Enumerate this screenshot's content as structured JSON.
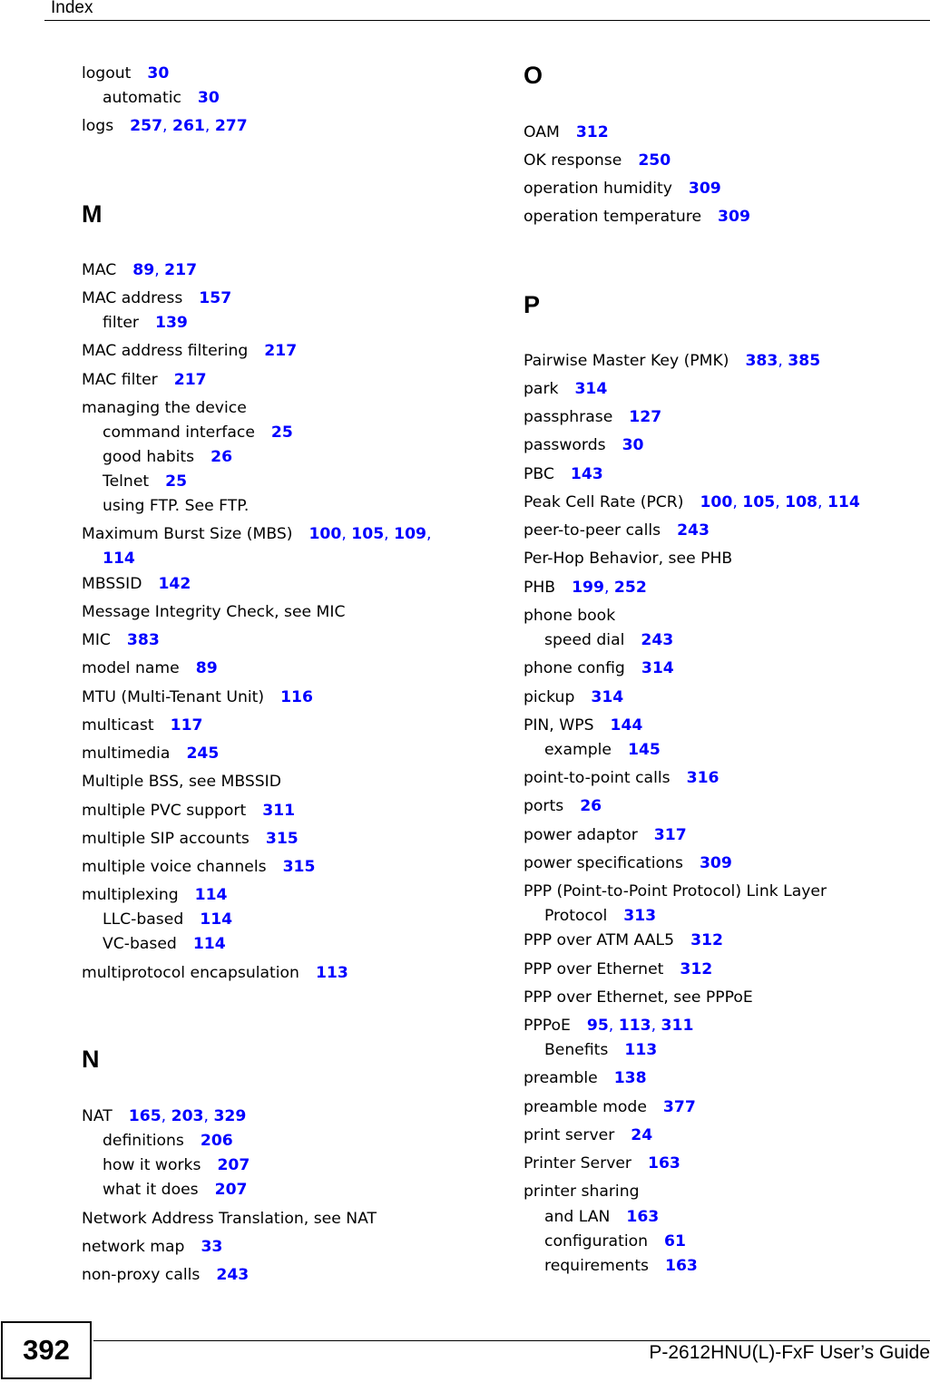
{
  "header": {
    "title": "Index"
  },
  "footer": {
    "page_number": "392",
    "guide_title": "P-2612HNU(L)-FxF User’s Guide"
  },
  "colors": {
    "page_link": "#0000ff",
    "text": "#000000"
  },
  "left_column": {
    "entries_top": [
      {
        "term": "logout",
        "pages": [
          "30"
        ],
        "level": 0
      },
      {
        "term": "automatic",
        "pages": [
          "30"
        ],
        "level": 1
      },
      {
        "term": "logs",
        "pages": [
          "257",
          "261",
          "277"
        ],
        "level": 0
      }
    ],
    "section_m": {
      "letter": "M",
      "entries": [
        {
          "term": "MAC",
          "pages": [
            "89",
            "217"
          ],
          "level": 0
        },
        {
          "term": "MAC address",
          "pages": [
            "157"
          ],
          "level": 0
        },
        {
          "term": "filter",
          "pages": [
            "139"
          ],
          "level": 1
        },
        {
          "term": "MAC address filtering",
          "pages": [
            "217"
          ],
          "level": 0
        },
        {
          "term": "MAC filter",
          "pages": [
            "217"
          ],
          "level": 0
        },
        {
          "term": "managing the device",
          "pages": [],
          "level": 0
        },
        {
          "term": "command interface",
          "pages": [
            "25"
          ],
          "level": 1
        },
        {
          "term": "good habits",
          "pages": [
            "26"
          ],
          "level": 1
        },
        {
          "term": "Telnet",
          "pages": [
            "25"
          ],
          "level": 1
        },
        {
          "term": "using FTP. See FTP.",
          "pages": [],
          "level": 1
        },
        {
          "term": "Maximum Burst Size (MBS)",
          "pages": [
            "100",
            "105",
            "109",
            "114"
          ],
          "level": 0
        },
        {
          "term": "MBSSID",
          "pages": [
            "142"
          ],
          "level": 0
        },
        {
          "term": "Message Integrity Check, see MIC",
          "pages": [],
          "level": 0
        },
        {
          "term": "MIC",
          "pages": [
            "383"
          ],
          "level": 0
        },
        {
          "term": "model name",
          "pages": [
            "89"
          ],
          "level": 0
        },
        {
          "term": "MTU (Multi-Tenant Unit)",
          "pages": [
            "116"
          ],
          "level": 0
        },
        {
          "term": "multicast",
          "pages": [
            "117"
          ],
          "level": 0
        },
        {
          "term": "multimedia",
          "pages": [
            "245"
          ],
          "level": 0
        },
        {
          "term": "Multiple BSS, see MBSSID",
          "pages": [],
          "level": 0
        },
        {
          "term": "multiple PVC support",
          "pages": [
            "311"
          ],
          "level": 0
        },
        {
          "term": "multiple SIP accounts",
          "pages": [
            "315"
          ],
          "level": 0
        },
        {
          "term": "multiple voice channels",
          "pages": [
            "315"
          ],
          "level": 0
        },
        {
          "term": "multiplexing",
          "pages": [
            "114"
          ],
          "level": 0
        },
        {
          "term": "LLC-based",
          "pages": [
            "114"
          ],
          "level": 1
        },
        {
          "term": "VC-based",
          "pages": [
            "114"
          ],
          "level": 1
        },
        {
          "term": "multiprotocol encapsulation",
          "pages": [
            "113"
          ],
          "level": 0
        }
      ]
    },
    "section_n": {
      "letter": "N",
      "entries": [
        {
          "term": "NAT",
          "pages": [
            "165",
            "203",
            "329"
          ],
          "level": 0
        },
        {
          "term": "definitions",
          "pages": [
            "206"
          ],
          "level": 1
        },
        {
          "term": "how it works",
          "pages": [
            "207"
          ],
          "level": 1
        },
        {
          "term": "what it does",
          "pages": [
            "207"
          ],
          "level": 1
        },
        {
          "term": "Network Address Translation, see NAT",
          "pages": [],
          "level": 0
        },
        {
          "term": "network map",
          "pages": [
            "33"
          ],
          "level": 0
        },
        {
          "term": "non-proxy calls",
          "pages": [
            "243"
          ],
          "level": 0
        }
      ]
    }
  },
  "right_column": {
    "section_o": {
      "letter": "O",
      "entries": [
        {
          "term": "OAM",
          "pages": [
            "312"
          ],
          "level": 0
        },
        {
          "term": "OK response",
          "pages": [
            "250"
          ],
          "level": 0
        },
        {
          "term": "operation humidity",
          "pages": [
            "309"
          ],
          "level": 0
        },
        {
          "term": "operation temperature",
          "pages": [
            "309"
          ],
          "level": 0
        }
      ]
    },
    "section_p": {
      "letter": "P",
      "entries": [
        {
          "term": "Pairwise Master Key (PMK)",
          "pages": [
            "383",
            "385"
          ],
          "level": 0
        },
        {
          "term": "park",
          "pages": [
            "314"
          ],
          "level": 0
        },
        {
          "term": "passphrase",
          "pages": [
            "127"
          ],
          "level": 0
        },
        {
          "term": "passwords",
          "pages": [
            "30"
          ],
          "level": 0
        },
        {
          "term": "PBC",
          "pages": [
            "143"
          ],
          "level": 0
        },
        {
          "term": "Peak Cell Rate (PCR)",
          "pages": [
            "100",
            "105",
            "108",
            "114"
          ],
          "level": 0
        },
        {
          "term": "peer-to-peer calls",
          "pages": [
            "243"
          ],
          "level": 0
        },
        {
          "term": "Per-Hop Behavior, see PHB",
          "pages": [],
          "level": 0
        },
        {
          "term": "PHB",
          "pages": [
            "199",
            "252"
          ],
          "level": 0
        },
        {
          "term": "phone book",
          "pages": [],
          "level": 0
        },
        {
          "term": "speed dial",
          "pages": [
            "243"
          ],
          "level": 1
        },
        {
          "term": "phone config",
          "pages": [
            "314"
          ],
          "level": 0
        },
        {
          "term": "pickup",
          "pages": [
            "314"
          ],
          "level": 0
        },
        {
          "term": "PIN, WPS",
          "pages": [
            "144"
          ],
          "level": 0
        },
        {
          "term": "example",
          "pages": [
            "145"
          ],
          "level": 1
        },
        {
          "term": "point-to-point calls",
          "pages": [
            "316"
          ],
          "level": 0
        },
        {
          "term": "ports",
          "pages": [
            "26"
          ],
          "level": 0
        },
        {
          "term": "power adaptor",
          "pages": [
            "317"
          ],
          "level": 0
        },
        {
          "term": "power specifications",
          "pages": [
            "309"
          ],
          "level": 0
        },
        {
          "term": "PPP (Point-to-Point Protocol) Link Layer Protocol",
          "pages": [
            "313"
          ],
          "level": 0
        },
        {
          "term": "PPP over ATM AAL5",
          "pages": [
            "312"
          ],
          "level": 0
        },
        {
          "term": "PPP over Ethernet",
          "pages": [
            "312"
          ],
          "level": 0
        },
        {
          "term": "PPP over Ethernet, see PPPoE",
          "pages": [],
          "level": 0
        },
        {
          "term": "PPPoE",
          "pages": [
            "95",
            "113",
            "311"
          ],
          "level": 0
        },
        {
          "term": "Benefits",
          "pages": [
            "113"
          ],
          "level": 1
        },
        {
          "term": "preamble",
          "pages": [
            "138"
          ],
          "level": 0
        },
        {
          "term": "preamble mode",
          "pages": [
            "377"
          ],
          "level": 0
        },
        {
          "term": "print server",
          "pages": [
            "24"
          ],
          "level": 0
        },
        {
          "term": "Printer Server",
          "pages": [
            "163"
          ],
          "level": 0
        },
        {
          "term": "printer sharing",
          "pages": [],
          "level": 0
        },
        {
          "term": "and LAN",
          "pages": [
            "163"
          ],
          "level": 1
        },
        {
          "term": "configuration",
          "pages": [
            "61"
          ],
          "level": 1
        },
        {
          "term": "requirements",
          "pages": [
            "163"
          ],
          "level": 1
        }
      ]
    }
  }
}
